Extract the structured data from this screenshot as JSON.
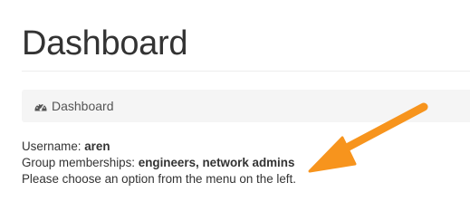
{
  "header": {
    "title": "Dashboard"
  },
  "breadcrumb": {
    "icon": "dashboard-gauge-icon",
    "label": "Dashboard"
  },
  "user_info": {
    "username_label": "Username:",
    "username_value": "aren",
    "groups_label": "Group memberships:",
    "groups_value": "engineers, network admins",
    "instruction": "Please choose an option from the menu on the left."
  },
  "annotation": {
    "arrow_icon": "orange-arrow-icon",
    "arrow_color": "#f7941d"
  },
  "colors": {
    "text": "#333333",
    "breadcrumb_background": "#f5f5f5",
    "breadcrumb_text": "#555555",
    "divider": "#eeeeee"
  }
}
